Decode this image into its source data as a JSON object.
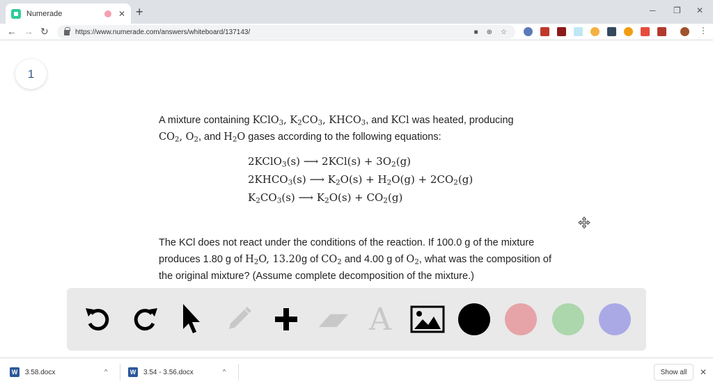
{
  "browser": {
    "tab_title": "Numerade",
    "tab_close": "✕",
    "new_tab": "+",
    "url": "https://www.numerade.com/answers/whiteboard/137143/",
    "back": "←",
    "forward": "→",
    "reload": "↻",
    "minimize": "─",
    "restore": "❐",
    "close": "✕"
  },
  "page": {
    "page_number": "1",
    "question_p1": {
      "t1": "A mixture containing ",
      "m1": "KClO",
      "m1s": "3",
      "m2": "K",
      "m2s": "2",
      "m3": "CO",
      "m3s": "3",
      "m4": "KHCO",
      "m4s": "3",
      "t2": ", and ",
      "m5": "KCl",
      "t3": " was heated, producing",
      "m6": "CO",
      "m6s": "2",
      "m7": "O",
      "m7s": "2",
      "t4": ", and ",
      "m8": "H",
      "m8s": "2",
      "m9": "O",
      "t5": " gases according to the following equations:"
    },
    "equations": {
      "e1": "2KClO",
      "e1s": "3",
      "e1r": "(s) ⟶ 2KCl(s) + 3O",
      "e1rs": "2",
      "e1e": "(g)",
      "e2": "2KHCO",
      "e2s": "3",
      "e2r1": "(s) ⟶ K",
      "e2r1s": "2",
      "e2r2": "O(s) + H",
      "e2r2s": "2",
      "e2r3": "O(g) + 2CO",
      "e2r3s": "2",
      "e2e": "(g)",
      "e3": "K",
      "e3s1": "2",
      "e3a": "CO",
      "e3s2": "3",
      "e3r1": "(s) ⟶ K",
      "e3r1s": "2",
      "e3r2": "O(s) + CO",
      "e3r2s": "2",
      "e3e": "(g)"
    },
    "question_p2": {
      "line1": "The KCl does not react under the conditions of the reaction. If 100.0 g of the mixture",
      "t1": "produces 1.80 g of ",
      "m1": "H",
      "m1s": "2",
      "m1b": "O, 13.20",
      "t2": "g of ",
      "m2": "CO",
      "m2s": "2",
      "t3": " and 4.00 g of ",
      "m3": "O",
      "m3s": "2",
      "t4": ", what was the composition of",
      "line3": "the original mixture? (Assume complete decomposition of the mixture.)"
    }
  },
  "whiteboard_toolbar": {
    "tools": [
      "undo-icon",
      "redo-icon",
      "pointer-icon",
      "pencil-icon",
      "plus-icon",
      "eraser-icon",
      "text-icon",
      "image-icon"
    ],
    "text_tool_glyph": "A",
    "colors": [
      "#000000",
      "#e6a4a8",
      "#acd6ac",
      "#aaa9e6"
    ]
  },
  "downloads": {
    "items": [
      {
        "name": "3.58.docx"
      },
      {
        "name": "3.54 - 3.56.docx"
      }
    ],
    "doc_glyph": "W",
    "chevron": "^",
    "show_all": "Show all",
    "close": "✕"
  }
}
